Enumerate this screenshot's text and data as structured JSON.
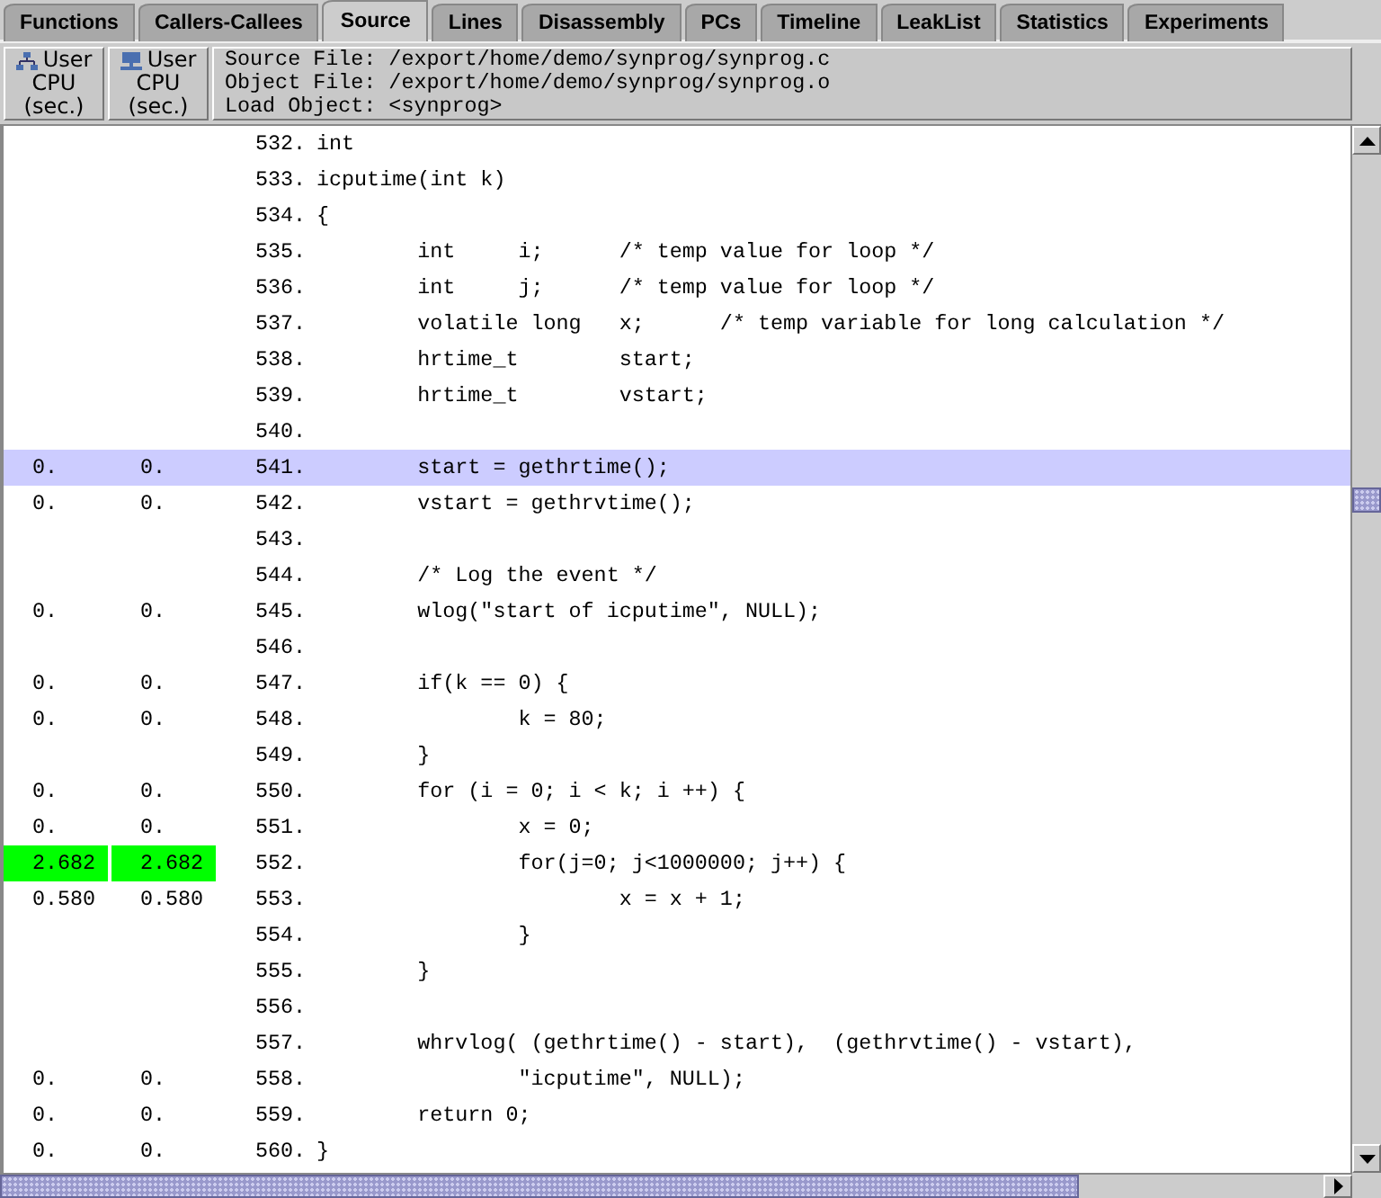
{
  "tabs": [
    {
      "label": "Functions",
      "selected": false
    },
    {
      "label": "Callers-Callees",
      "selected": false
    },
    {
      "label": "Source",
      "selected": true
    },
    {
      "label": "Lines",
      "selected": false
    },
    {
      "label": "Disassembly",
      "selected": false
    },
    {
      "label": "PCs",
      "selected": false
    },
    {
      "label": "Timeline",
      "selected": false
    },
    {
      "label": "LeakList",
      "selected": false
    },
    {
      "label": "Statistics",
      "selected": false
    },
    {
      "label": "Experiments",
      "selected": false
    }
  ],
  "columns": [
    {
      "kind": "inclusive",
      "lines": [
        "User",
        "CPU",
        "(sec.)"
      ]
    },
    {
      "kind": "exclusive",
      "lines": [
        "User",
        "CPU",
        "(sec.)"
      ]
    }
  ],
  "source_header": [
    "Source File: /export/home/demo/synprog/synprog.c",
    "Object File: /export/home/demo/synprog/synprog.o",
    "Load Object: <synprog>"
  ],
  "rows": [
    {
      "line": "532.",
      "code": "int",
      "metrics": [],
      "selected": false,
      "hot": false
    },
    {
      "line": "533.",
      "code": "icputime(int k)",
      "metrics": [],
      "selected": false,
      "hot": false
    },
    {
      "line": "534.",
      "code": "{",
      "metrics": [],
      "selected": false,
      "hot": false
    },
    {
      "line": "535.",
      "code": "        int     i;      /* temp value for loop */",
      "metrics": [],
      "selected": false,
      "hot": false
    },
    {
      "line": "536.",
      "code": "        int     j;      /* temp value for loop */",
      "metrics": [],
      "selected": false,
      "hot": false
    },
    {
      "line": "537.",
      "code": "        volatile long   x;      /* temp variable for long calculation */",
      "metrics": [],
      "selected": false,
      "hot": false
    },
    {
      "line": "538.",
      "code": "        hrtime_t        start;",
      "metrics": [],
      "selected": false,
      "hot": false
    },
    {
      "line": "539.",
      "code": "        hrtime_t        vstart;",
      "metrics": [],
      "selected": false,
      "hot": false
    },
    {
      "line": "540.",
      "code": "",
      "metrics": [],
      "selected": false,
      "hot": false
    },
    {
      "line": "541.",
      "code": "        start = gethrtime();",
      "metrics": [
        "0.",
        "0."
      ],
      "selected": true,
      "hot": false
    },
    {
      "line": "542.",
      "code": "        vstart = gethrvtime();",
      "metrics": [
        "0.",
        "0."
      ],
      "selected": false,
      "hot": false
    },
    {
      "line": "543.",
      "code": "",
      "metrics": [],
      "selected": false,
      "hot": false
    },
    {
      "line": "544.",
      "code": "        /* Log the event */",
      "metrics": [],
      "selected": false,
      "hot": false
    },
    {
      "line": "545.",
      "code": "        wlog(\"start of icputime\", NULL);",
      "metrics": [
        "0.",
        "0."
      ],
      "selected": false,
      "hot": false
    },
    {
      "line": "546.",
      "code": "",
      "metrics": [],
      "selected": false,
      "hot": false
    },
    {
      "line": "547.",
      "code": "        if(k == 0) {",
      "metrics": [
        "0.",
        "0."
      ],
      "selected": false,
      "hot": false
    },
    {
      "line": "548.",
      "code": "                k = 80;",
      "metrics": [
        "0.",
        "0."
      ],
      "selected": false,
      "hot": false
    },
    {
      "line": "549.",
      "code": "        }",
      "metrics": [],
      "selected": false,
      "hot": false
    },
    {
      "line": "550.",
      "code": "        for (i = 0; i < k; i ++) {",
      "metrics": [
        "0.",
        "0."
      ],
      "selected": false,
      "hot": false
    },
    {
      "line": "551.",
      "code": "                x = 0;",
      "metrics": [
        "0.",
        "0."
      ],
      "selected": false,
      "hot": false
    },
    {
      "line": "552.",
      "code": "                for(j=0; j<1000000; j++) {",
      "metrics": [
        "2.682",
        "2.682"
      ],
      "selected": false,
      "hot": true
    },
    {
      "line": "553.",
      "code": "                        x = x + 1;",
      "metrics": [
        "0.580",
        "0.580"
      ],
      "selected": false,
      "hot": false
    },
    {
      "line": "554.",
      "code": "                }",
      "metrics": [],
      "selected": false,
      "hot": false
    },
    {
      "line": "555.",
      "code": "        }",
      "metrics": [],
      "selected": false,
      "hot": false
    },
    {
      "line": "556.",
      "code": "",
      "metrics": [],
      "selected": false,
      "hot": false
    },
    {
      "line": "557.",
      "code": "        whrvlog( (gethrtime() - start),  (gethrvtime() - vstart),",
      "metrics": [],
      "selected": false,
      "hot": false
    },
    {
      "line": "558.",
      "code": "                \"icputime\", NULL);",
      "metrics": [
        "0.",
        "0."
      ],
      "selected": false,
      "hot": false
    },
    {
      "line": "559.",
      "code": "        return 0;",
      "metrics": [
        "0.",
        "0."
      ],
      "selected": false,
      "hot": false
    },
    {
      "line": "560.",
      "code": "}",
      "metrics": [
        "0.",
        "0."
      ],
      "selected": false,
      "hot": false
    }
  ]
}
